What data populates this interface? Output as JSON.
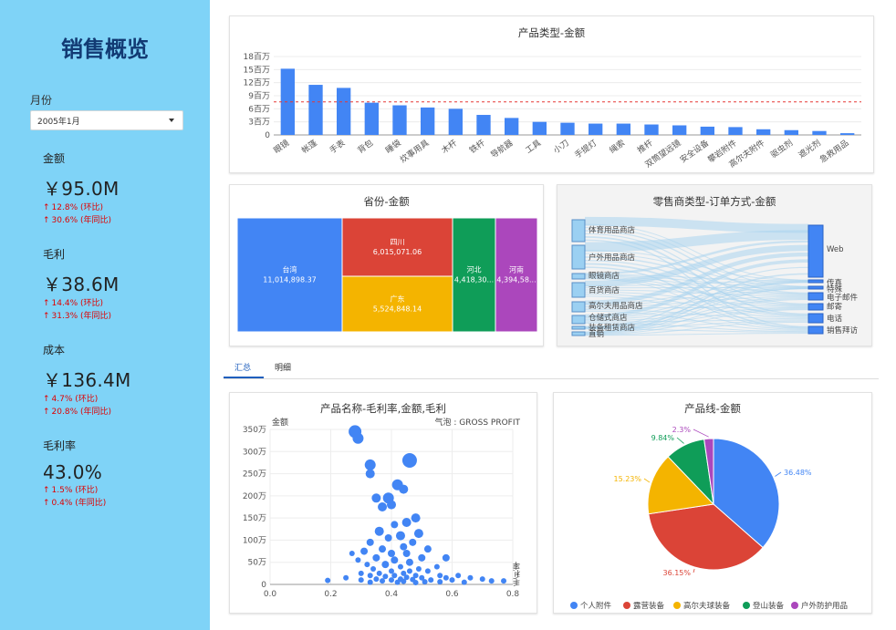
{
  "sidebar": {
    "title": "销售概览",
    "month_label": "月份",
    "month_value": "2005年1月",
    "kpis": [
      {
        "label": "金额",
        "value": "￥95.0M",
        "mom": "12.8% (环比)",
        "yoy": "30.6% (年同比)"
      },
      {
        "label": "毛利",
        "value": "￥38.6M",
        "mom": "14.4% (环比)",
        "yoy": "31.3% (年同比)"
      },
      {
        "label": "成本",
        "value": "￥136.4M",
        "mom": "4.7% (环比)",
        "yoy": "20.8% (年同比)"
      },
      {
        "label": "毛利率",
        "value": "43.0%",
        "mom": "1.5% (环比)",
        "yoy": "0.4% (年同比)"
      }
    ],
    "up_color": "#e00000"
  },
  "tabs": [
    {
      "label": "汇总",
      "active": true
    },
    {
      "label": "明细",
      "active": false
    }
  ],
  "charts": {
    "bar_title": "产品类型-金额",
    "treemap_title": "省份-金额",
    "sankey_title": "零售商类型-订单方式-金额",
    "scatter_title": "产品名称-毛利率,金额,毛利",
    "scatter_size_label": "气泡 : GROSS PROFIT",
    "scatter_ylabel": "金额",
    "scatter_xlabel": "毛利率",
    "pie_title": "产品线-金额"
  },
  "chart_data": [
    {
      "type": "bar",
      "title": "产品类型-金额",
      "categories": [
        "眼镜",
        "帐篷",
        "手表",
        "背包",
        "睡袋",
        "炊事用具",
        "木杆",
        "铁杆",
        "导航器",
        "工具",
        "小刀",
        "手提灯",
        "绳索",
        "推杆",
        "双筒望远镜",
        "安全设备",
        "攀岩附件",
        "高尔夫附件",
        "驱虫剂",
        "遮光剂",
        "急救用品"
      ],
      "values": [
        15.2,
        11.5,
        10.8,
        7.4,
        6.8,
        6.3,
        6.0,
        4.6,
        3.9,
        3.0,
        2.8,
        2.6,
        2.6,
        2.4,
        2.2,
        1.9,
        1.8,
        1.3,
        1.1,
        0.9,
        0.4
      ],
      "unit": "百万",
      "ylim": [
        0,
        18
      ],
      "yticks": [
        "0",
        "3百万",
        "6百万",
        "9百万",
        "12百万",
        "15百万",
        "18百万"
      ],
      "average_line": 7.6,
      "bar_color": "#4285f4",
      "average_line_color": "#e53935"
    },
    {
      "type": "treemap",
      "title": "省份-金额",
      "items": [
        {
          "name": "台湾",
          "value": "11,014,898.37",
          "color": "#4285f4"
        },
        {
          "name": "四川",
          "value": "6,015,071.06",
          "color": "#db4437"
        },
        {
          "name": "广东",
          "value": "5,524,848.14",
          "color": "#f4b400"
        },
        {
          "name": "河北",
          "value": "4,418,30...",
          "color": "#0f9d58"
        },
        {
          "name": "河南",
          "value": "4,394,58...",
          "color": "#ab47bc"
        }
      ]
    },
    {
      "type": "sankey",
      "title": "零售商类型-订单方式-金额",
      "sources": [
        "体育用品商店",
        "户外用品商店",
        "眼镜商店",
        "百货商店",
        "高尔夫用品商店",
        "仓储式商店",
        "装备租赁商店",
        "直销"
      ],
      "targets": [
        "Web",
        "传真",
        "特殊",
        "电子邮件",
        "邮寄",
        "电话",
        "销售拜访"
      ],
      "node_color": "#4285f4",
      "link_color": "#aad4ef"
    },
    {
      "type": "scatter",
      "title": "产品名称-毛利率,金额,毛利",
      "xlabel": "毛利率",
      "ylabel": "金额",
      "xlim": [
        0.0,
        0.8
      ],
      "ylim": [
        0,
        3500000
      ],
      "xticks": [
        "0.0",
        "0.2",
        "0.4",
        "0.6",
        "0.8"
      ],
      "yticks": [
        "0",
        "50万",
        "100万",
        "150万",
        "200万",
        "250万",
        "300万",
        "350万"
      ],
      "color": "#4285f4",
      "points": [
        [
          0.28,
          3450000,
          7
        ],
        [
          0.29,
          3300000,
          6
        ],
        [
          0.46,
          2800000,
          8
        ],
        [
          0.33,
          2700000,
          6
        ],
        [
          0.33,
          2500000,
          5
        ],
        [
          0.42,
          2250000,
          6
        ],
        [
          0.44,
          2150000,
          5
        ],
        [
          0.39,
          1950000,
          6
        ],
        [
          0.35,
          1950000,
          5
        ],
        [
          0.4,
          1800000,
          5
        ],
        [
          0.37,
          1750000,
          5
        ],
        [
          0.48,
          1500000,
          5
        ],
        [
          0.45,
          1400000,
          5
        ],
        [
          0.41,
          1350000,
          4
        ],
        [
          0.36,
          1200000,
          5
        ],
        [
          0.49,
          1150000,
          5
        ],
        [
          0.43,
          1100000,
          5
        ],
        [
          0.39,
          1050000,
          4
        ],
        [
          0.47,
          950000,
          4
        ],
        [
          0.33,
          950000,
          4
        ],
        [
          0.44,
          850000,
          4
        ],
        [
          0.37,
          800000,
          4
        ],
        [
          0.52,
          800000,
          4
        ],
        [
          0.31,
          750000,
          4
        ],
        [
          0.4,
          700000,
          4
        ],
        [
          0.45,
          700000,
          4
        ],
        [
          0.27,
          700000,
          3
        ],
        [
          0.35,
          600000,
          4
        ],
        [
          0.5,
          600000,
          4
        ],
        [
          0.58,
          600000,
          4
        ],
        [
          0.29,
          550000,
          3
        ],
        [
          0.41,
          550000,
          4
        ],
        [
          0.46,
          500000,
          4
        ],
        [
          0.38,
          450000,
          4
        ],
        [
          0.32,
          450000,
          3
        ],
        [
          0.43,
          400000,
          3
        ],
        [
          0.55,
          400000,
          3
        ],
        [
          0.49,
          350000,
          3
        ],
        [
          0.34,
          350000,
          3
        ],
        [
          0.4,
          300000,
          3
        ],
        [
          0.46,
          300000,
          3
        ],
        [
          0.52,
          300000,
          3
        ],
        [
          0.36,
          250000,
          3
        ],
        [
          0.44,
          250000,
          3
        ],
        [
          0.3,
          250000,
          3
        ],
        [
          0.48,
          200000,
          3
        ],
        [
          0.41,
          200000,
          3
        ],
        [
          0.56,
          200000,
          3
        ],
        [
          0.62,
          200000,
          3
        ],
        [
          0.33,
          200000,
          3
        ],
        [
          0.38,
          180000,
          3
        ],
        [
          0.45,
          160000,
          3
        ],
        [
          0.5,
          150000,
          3
        ],
        [
          0.25,
          150000,
          3
        ],
        [
          0.58,
          150000,
          3
        ],
        [
          0.66,
          150000,
          3
        ],
        [
          0.7,
          120000,
          3
        ],
        [
          0.35,
          120000,
          3
        ],
        [
          0.43,
          120000,
          3
        ],
        [
          0.47,
          110000,
          3
        ],
        [
          0.53,
          100000,
          3
        ],
        [
          0.6,
          100000,
          3
        ],
        [
          0.4,
          100000,
          3
        ],
        [
          0.3,
          100000,
          3
        ],
        [
          0.73,
          80000,
          3
        ],
        [
          0.77,
          80000,
          3
        ],
        [
          0.19,
          90000,
          3
        ],
        [
          0.37,
          80000,
          3
        ],
        [
          0.44,
          70000,
          3
        ],
        [
          0.51,
          60000,
          3
        ],
        [
          0.56,
          60000,
          3
        ],
        [
          0.64,
          50000,
          3
        ],
        [
          0.42,
          50000,
          3
        ],
        [
          0.33,
          50000,
          3
        ],
        [
          0.48,
          40000,
          3
        ]
      ]
    },
    {
      "type": "pie",
      "title": "产品线-金额",
      "slices": [
        {
          "name": "个人附件",
          "value": 36.48,
          "color": "#4285f4"
        },
        {
          "name": "露营装备",
          "value": 36.15,
          "color": "#db4437"
        },
        {
          "name": "高尔夫球装备",
          "value": 15.23,
          "color": "#f4b400"
        },
        {
          "name": "登山装备",
          "value": 9.84,
          "color": "#0f9d58"
        },
        {
          "name": "户外防护用品",
          "value": 2.3,
          "color": "#ab47bc"
        }
      ],
      "labels": [
        "36.48%",
        "36.15%",
        "15.23%",
        "9.84%",
        "2.3%"
      ]
    }
  ]
}
